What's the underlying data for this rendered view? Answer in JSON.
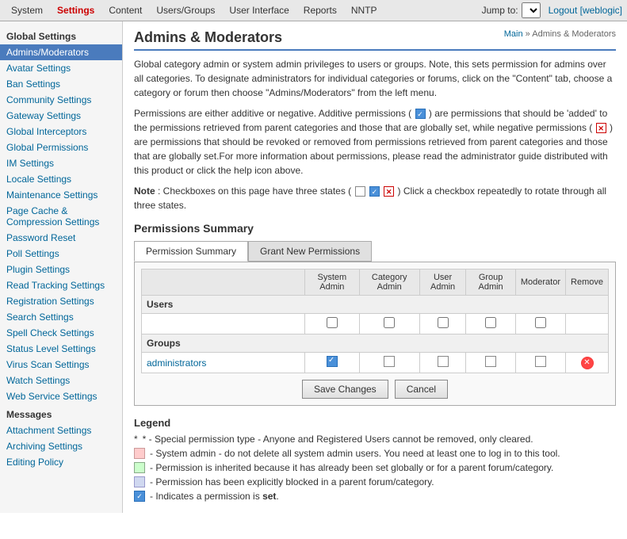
{
  "topnav": {
    "items": [
      {
        "label": "System",
        "id": "system",
        "active": false
      },
      {
        "label": "Settings",
        "id": "settings",
        "active": true
      },
      {
        "label": "Content",
        "id": "content",
        "active": false
      },
      {
        "label": "Users/Groups",
        "id": "users-groups",
        "active": false
      },
      {
        "label": "User Interface",
        "id": "user-interface",
        "active": false
      },
      {
        "label": "Reports",
        "id": "reports",
        "active": false
      },
      {
        "label": "NNTP",
        "id": "nntp",
        "active": false
      }
    ],
    "jump_to_label": "Jump to:",
    "logout_label": "Logout [weblogic]"
  },
  "sidebar": {
    "global_settings_label": "Global Settings",
    "items": [
      {
        "label": "Admins/Moderators",
        "id": "admins-moderators",
        "active": true
      },
      {
        "label": "Avatar Settings",
        "id": "avatar-settings"
      },
      {
        "label": "Ban Settings",
        "id": "ban-settings"
      },
      {
        "label": "Community Settings",
        "id": "community-settings"
      },
      {
        "label": "Gateway Settings",
        "id": "gateway-settings"
      },
      {
        "label": "Global Interceptors",
        "id": "global-interceptors"
      },
      {
        "label": "Global Permissions",
        "id": "global-permissions"
      },
      {
        "label": "IM Settings",
        "id": "im-settings"
      },
      {
        "label": "Locale Settings",
        "id": "locale-settings"
      },
      {
        "label": "Maintenance Settings",
        "id": "maintenance-settings"
      },
      {
        "label": "Page Cache & Compression Settings",
        "id": "page-cache"
      },
      {
        "label": "Password Reset",
        "id": "password-reset"
      },
      {
        "label": "Poll Settings",
        "id": "poll-settings"
      },
      {
        "label": "Plugin Settings",
        "id": "plugin-settings"
      },
      {
        "label": "Read Tracking Settings",
        "id": "read-tracking"
      },
      {
        "label": "Registration Settings",
        "id": "registration-settings"
      },
      {
        "label": "Search Settings",
        "id": "search-settings"
      },
      {
        "label": "Spell Check Settings",
        "id": "spell-check"
      },
      {
        "label": "Status Level Settings",
        "id": "status-level"
      },
      {
        "label": "Virus Scan Settings",
        "id": "virus-scan"
      },
      {
        "label": "Watch Settings",
        "id": "watch-settings"
      },
      {
        "label": "Web Service Settings",
        "id": "web-service"
      }
    ],
    "messages_label": "Messages",
    "message_items": [
      {
        "label": "Attachment Settings",
        "id": "attachment-settings"
      },
      {
        "label": "Archiving Settings",
        "id": "archiving-settings"
      },
      {
        "label": "Editing Policy",
        "id": "editing-policy"
      }
    ]
  },
  "main": {
    "title": "Admins & Moderators",
    "breadcrumb": "Main » Admins & Moderators",
    "intro_p1": "Global category admin or system admin privileges to users or groups. Note, this sets permission for admins over all categories. To designate administrators for individual categories or forums, click on the \"Content\" tab, choose a category or forum then choose \"Admins/Moderators\" from the left menu.",
    "intro_p2_pre": "Permissions are either additive or negative. Additive permissions (",
    "intro_p2_mid": ") are permissions that should be 'added' to the permissions retrieved from parent categories and those that are globally set, while negative permissions (",
    "intro_p2_post": ") are permissions that should be revoked or removed from permissions retrieved from parent categories and those that are globally set.For more information about permissions, please read the administrator guide distributed with this product or click the help icon above.",
    "note_prefix": "Note",
    "note_text": ": Checkboxes on this page have three states (",
    "note_suffix": ") Click a checkbox repeatedly to rotate through all three states.",
    "permissions_summary_label": "Permissions Summary",
    "tabs": [
      {
        "label": "Permission Summary",
        "id": "permission-summary",
        "active": true
      },
      {
        "label": "Grant New Permissions",
        "id": "grant-new-permissions"
      }
    ],
    "table": {
      "col_headers": [
        "System Admin",
        "Category Admin",
        "User Admin",
        "Group Admin",
        "Moderator",
        "Remove"
      ],
      "users_label": "Users",
      "groups_label": "Groups",
      "administrators_link": "administrators",
      "save_button": "Save Changes",
      "cancel_button": "Cancel"
    },
    "legend": {
      "title": "Legend",
      "items": [
        {
          "type": "text",
          "text": "* - Special permission type - Anyone and Registered Users cannot be removed, only cleared."
        },
        {
          "type": "pink",
          "text": "- System admin - do not delete all system admin users. You need at least one to log in to this tool."
        },
        {
          "type": "green",
          "text": "- Permission is inherited because it has already been set globally or for a parent forum/category."
        },
        {
          "type": "blue",
          "text": "- Permission has been explicitly blocked in a parent forum/category."
        },
        {
          "type": "checked",
          "text": "- Indicates a permission is set."
        }
      ]
    }
  }
}
